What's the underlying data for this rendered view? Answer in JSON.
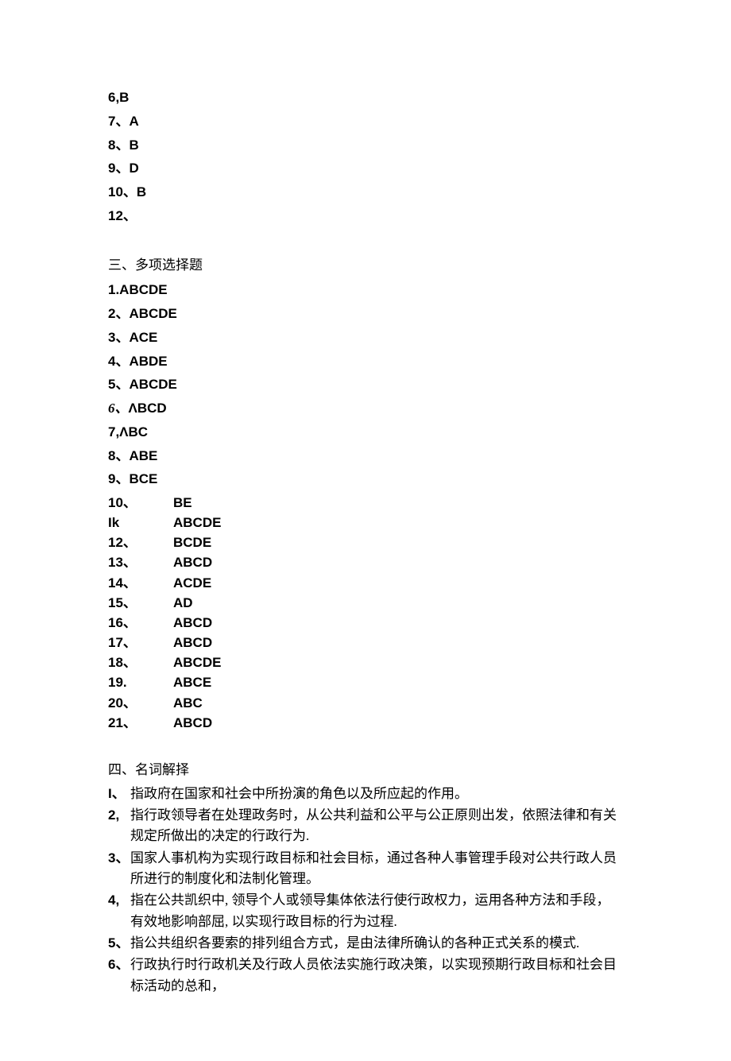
{
  "single_choice_tail": [
    {
      "num": "6,",
      "ans": "B"
    },
    {
      "num": "7、",
      "ans": "A"
    },
    {
      "num": "8、",
      "ans": "B"
    },
    {
      "num": "9、",
      "ans": "D"
    },
    {
      "num": "10、",
      "ans": "B"
    },
    {
      "num": "12、",
      "ans": ""
    }
  ],
  "section_multi_title": "三、多项选择题",
  "multi_choice_top": [
    {
      "num": "1.",
      "ans": "ABCDE"
    },
    {
      "num": "2、",
      "ans": "ABCDE"
    },
    {
      "num": "3、",
      "ans": "ACE"
    },
    {
      "num": "4、",
      "ans": "ABDE"
    },
    {
      "num": "5、",
      "ans": "ABCDE"
    },
    {
      "num": "6、",
      "ans": "ΛBCD",
      "num_cn": true
    },
    {
      "num": "7,",
      "ans": "ΛBC"
    },
    {
      "num": "8、",
      "ans": "ABE"
    },
    {
      "num": "9、",
      "ans": "BCE"
    }
  ],
  "multi_choice_table": [
    {
      "num": "10、",
      "ans": "BE"
    },
    {
      "num": "Ik",
      "ans": "ABCDE"
    },
    {
      "num": "12、",
      "ans": "BCDE"
    },
    {
      "num": "13、",
      "ans": "ABCD"
    },
    {
      "num": "14、",
      "ans": "ACDE"
    },
    {
      "num": "15、",
      "ans": "AD"
    },
    {
      "num": "16、",
      "ans": "ABCD"
    },
    {
      "num": "17、",
      "ans": "ABCD"
    },
    {
      "num": "18、",
      "ans": "ABCDE"
    },
    {
      "num": "19.",
      "ans": "ABCE"
    },
    {
      "num": "20、",
      "ans": "ABC"
    },
    {
      "num": "21、",
      "ans": "ABCD"
    }
  ],
  "section_def_title": "四、名词解择",
  "definitions": [
    {
      "idx": "I、",
      "idx_bold": true,
      "text": "指政府在国家和社会中所扮演的角色以及所应起的作用。"
    },
    {
      "idx": "2,",
      "idx_bold": true,
      "text": "指行政领导者在处理政务时，从公共利益和公平与公正原则出发，依照法律和有关规定所做出的决定的行政行为."
    },
    {
      "idx": "3、",
      "idx_bold": true,
      "text": "国家人事机构为实现行政目标和社会目标，通过各种人事管理手段对公共行政人员所进行的制度化和法制化管理。"
    },
    {
      "idx": "4,",
      "idx_bold": true,
      "text": "指在公共凯织中, 领导个人或领导集体依法行使行政权力，运用各种方法和手段，有效地影响部屈, 以实现行政目标的行为过程."
    },
    {
      "idx": "5、",
      "idx_bold": true,
      "text": "指公共组织各要索的排列组合方式，是由法律所确认的各种正式关系的模式."
    },
    {
      "idx": "6、",
      "idx_bold": true,
      "text": "行政执行时行政机关及行政人员依法实施行政决策，以实现预期行政目标和社会目标活动的总和，"
    }
  ]
}
